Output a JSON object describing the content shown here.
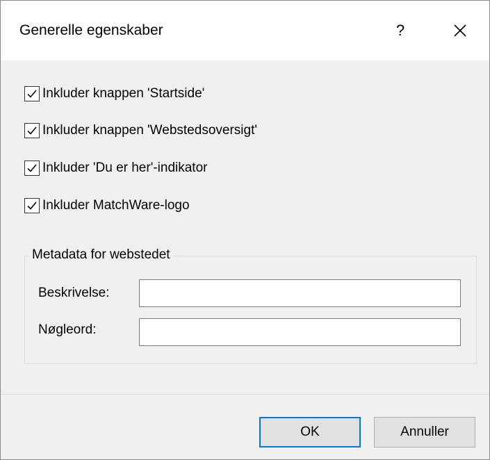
{
  "dialog": {
    "title": "Generelle egenskaber",
    "help_label": "?"
  },
  "options": [
    {
      "label": "Inkluder knappen 'Startside'",
      "checked": true
    },
    {
      "label": "Inkluder knappen 'Webstedsoversigt'",
      "checked": true
    },
    {
      "label": "Inkluder 'Du er her'-indikator",
      "checked": true
    },
    {
      "label": "Inkluder MatchWare-logo",
      "checked": true
    }
  ],
  "metadata": {
    "group_title": "Metadata for webstedet",
    "description_label": "Beskrivelse:",
    "description_value": "",
    "keywords_label": "Nøgleord:",
    "keywords_value": ""
  },
  "buttons": {
    "ok": "OK",
    "cancel": "Annuller"
  },
  "colors": {
    "accent": "#0078d7",
    "dialog_bg": "#f0f0f0",
    "title_bg": "#ffffff"
  },
  "icons": {
    "close": "close-icon",
    "check": "checkmark-icon"
  }
}
